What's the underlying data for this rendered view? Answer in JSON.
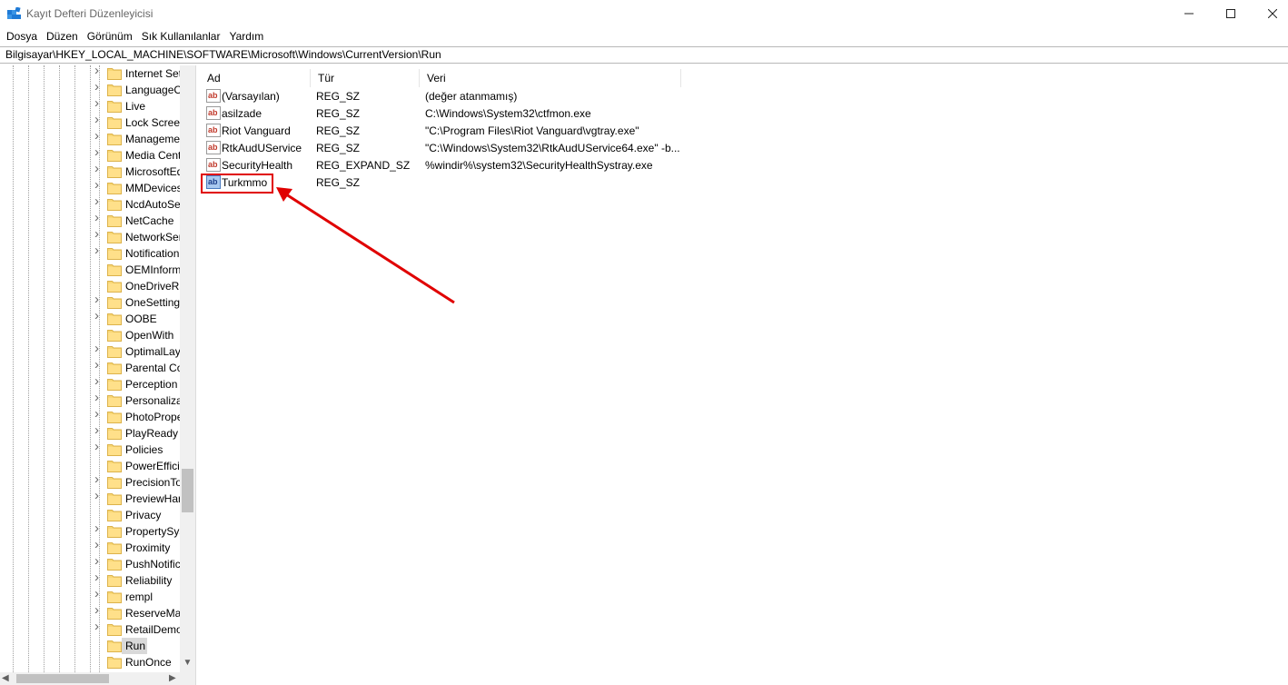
{
  "window": {
    "title": "Kayıt Defteri Düzenleyicisi"
  },
  "menu": [
    "Dosya",
    "Düzen",
    "Görünüm",
    "Sık Kullanılanlar",
    "Yardım"
  ],
  "address": "Bilgisayar\\HKEY_LOCAL_MACHINE\\SOFTWARE\\Microsoft\\Windows\\CurrentVersion\\Run",
  "tree": {
    "items": [
      {
        "label": "Internet Set",
        "expandable": true
      },
      {
        "label": "LanguageC",
        "expandable": true
      },
      {
        "label": "Live",
        "expandable": true
      },
      {
        "label": "Lock Screer",
        "expandable": true
      },
      {
        "label": "Manageme",
        "expandable": true
      },
      {
        "label": "Media Cent",
        "expandable": true
      },
      {
        "label": "MicrosoftEd",
        "expandable": true
      },
      {
        "label": "MMDevices",
        "expandable": true
      },
      {
        "label": "NcdAutoSe",
        "expandable": true
      },
      {
        "label": "NetCache",
        "expandable": true
      },
      {
        "label": "NetworkSer",
        "expandable": true
      },
      {
        "label": "Notification",
        "expandable": true
      },
      {
        "label": "OEMInform",
        "expandable": false
      },
      {
        "label": "OneDriveRa",
        "expandable": false
      },
      {
        "label": "OneSetting",
        "expandable": true
      },
      {
        "label": "OOBE",
        "expandable": true
      },
      {
        "label": "OpenWith",
        "expandable": false
      },
      {
        "label": "OptimalLay",
        "expandable": true
      },
      {
        "label": "Parental Co",
        "expandable": true
      },
      {
        "label": "Perception",
        "expandable": true
      },
      {
        "label": "Personaliza",
        "expandable": true
      },
      {
        "label": "PhotoPrope",
        "expandable": true
      },
      {
        "label": "PlayReady",
        "expandable": true
      },
      {
        "label": "Policies",
        "expandable": true
      },
      {
        "label": "PowerEffici",
        "expandable": false
      },
      {
        "label": "PrecisionTo",
        "expandable": true
      },
      {
        "label": "PreviewHar",
        "expandable": true
      },
      {
        "label": "Privacy",
        "expandable": false
      },
      {
        "label": "PropertySys",
        "expandable": true
      },
      {
        "label": "Proximity",
        "expandable": true
      },
      {
        "label": "PushNotific",
        "expandable": true
      },
      {
        "label": "Reliability",
        "expandable": true
      },
      {
        "label": "rempl",
        "expandable": true
      },
      {
        "label": "ReserveMar",
        "expandable": true
      },
      {
        "label": "RetailDemo",
        "expandable": true
      },
      {
        "label": "Run",
        "expandable": false,
        "selected": true
      },
      {
        "label": "RunOnce",
        "expandable": false
      }
    ]
  },
  "list": {
    "columns": {
      "name": "Ad",
      "type": "Tür",
      "data": "Veri"
    },
    "rows": [
      {
        "name": "(Varsayılan)",
        "type": "REG_SZ",
        "data": "(değer atanmamış)",
        "icon": "string-value-icon"
      },
      {
        "name": "asilzade",
        "type": "REG_SZ",
        "data": "C:\\Windows\\System32\\ctfmon.exe",
        "icon": "string-value-icon"
      },
      {
        "name": "Riot Vanguard",
        "type": "REG_SZ",
        "data": "\"C:\\Program Files\\Riot Vanguard\\vgtray.exe\"",
        "icon": "string-value-icon"
      },
      {
        "name": "RtkAudUService",
        "type": "REG_SZ",
        "data": "\"C:\\Windows\\System32\\RtkAudUService64.exe\" -b...",
        "icon": "string-value-icon"
      },
      {
        "name": "SecurityHealth",
        "type": "REG_EXPAND_SZ",
        "data": "%windir%\\system32\\SecurityHealthSystray.exe",
        "icon": "string-value-icon"
      },
      {
        "name": "Turkmmo",
        "type": "REG_SZ",
        "data": "",
        "icon": "string-value-icon",
        "selected": true
      }
    ]
  },
  "annotation": {
    "color": "#e00000"
  }
}
